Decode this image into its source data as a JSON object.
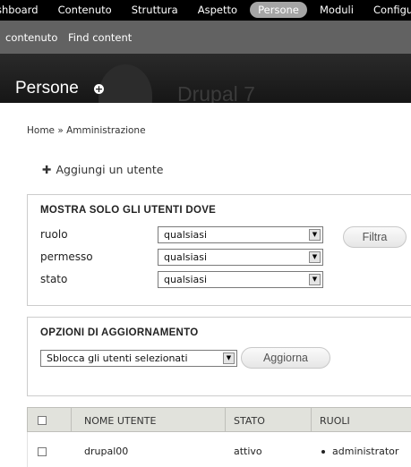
{
  "toolbar": {
    "items": [
      "shboard",
      "Contenuto",
      "Struttura",
      "Aspetto",
      "Persone",
      "Moduli",
      "Configuraz"
    ],
    "active": "Persone"
  },
  "shortcuts": {
    "items": [
      "contenuto",
      "Find content"
    ]
  },
  "header": {
    "page_title": "Persone",
    "site_name": "Drupal 7"
  },
  "breadcrumb": "Home » Amministrazione",
  "add_user": {
    "label": "Aggiungi un utente"
  },
  "filter": {
    "legend": "MOSTRA SOLO GLI UTENTI DOVE",
    "fields": [
      {
        "label": "ruolo",
        "value": "qualsiasi"
      },
      {
        "label": "permesso",
        "value": "qualsiasi"
      },
      {
        "label": "stato",
        "value": "qualsiasi"
      }
    ],
    "button": "Filtra"
  },
  "update": {
    "legend": "OPZIONI DI AGGIORNAMENTO",
    "select_value": "Sblocca gli utenti selezionati",
    "button": "Aggiorna"
  },
  "table": {
    "headers": [
      "NOME UTENTE",
      "STATO",
      "RUOLI"
    ],
    "rows": [
      {
        "username": "drupal00",
        "status": "attivo",
        "roles": [
          "administrator"
        ]
      }
    ]
  }
}
